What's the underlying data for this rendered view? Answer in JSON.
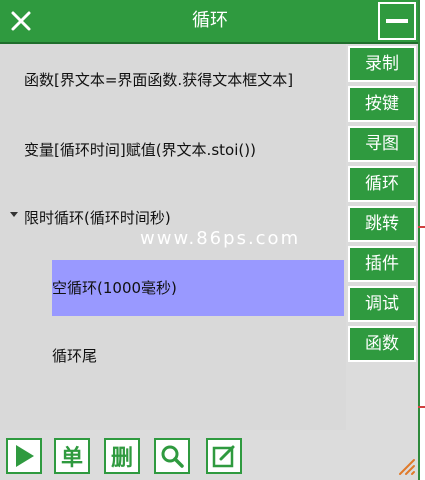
{
  "window": {
    "title": "循环"
  },
  "list": {
    "rows": [
      {
        "text": "函数[界文本=界面函数.获得文本框文本]"
      },
      {
        "text": "变量[循环时间]赋值(界文本.stoi())"
      },
      {
        "text": "限时循环(循环时间秒)"
      },
      {
        "text": "空循环(1000毫秒)"
      },
      {
        "text": "循环尾"
      }
    ]
  },
  "watermark": "www.86ps.com",
  "sidebar": {
    "items": [
      {
        "label": "录制"
      },
      {
        "label": "按键"
      },
      {
        "label": "寻图"
      },
      {
        "label": "循环"
      },
      {
        "label": "跳转"
      },
      {
        "label": "插件"
      },
      {
        "label": "调试"
      },
      {
        "label": "函数"
      }
    ]
  },
  "toolbar": {
    "single_label": "单",
    "delete_label": "删"
  },
  "colors": {
    "accent": "#2f9a3f",
    "selected_row": "#9999ff",
    "panel": "#d9d9d9"
  }
}
